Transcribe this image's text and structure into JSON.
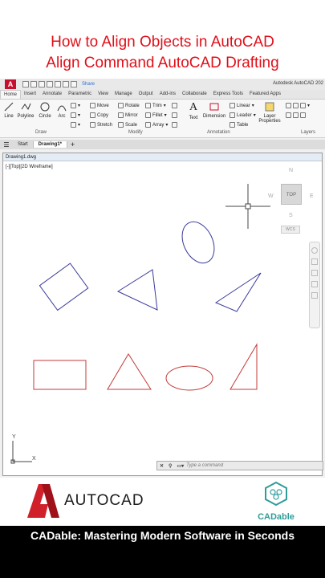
{
  "header": {
    "title_line1": "How to Align Objects in AutoCAD",
    "title_line2": "Align Command AutoCAD Drafting"
  },
  "qat": {
    "app_letter": "A",
    "share": "Share",
    "app_title": "Autodesk AutoCAD 202"
  },
  "tabs": [
    "Home",
    "Insert",
    "Annotate",
    "Parametric",
    "View",
    "Manage",
    "Output",
    "Add-ins",
    "Collaborate",
    "Express Tools",
    "Featured Apps"
  ],
  "ribbon": {
    "draw_tools": [
      "Line",
      "Polyline",
      "Circle",
      "Arc"
    ],
    "modify_tools": [
      "Move",
      "Rotate",
      "Trim",
      "Copy",
      "Mirror",
      "Fillet",
      "Stretch",
      "Scale",
      "Array"
    ],
    "annotation_tools": [
      "Text",
      "Dimension",
      "Linear",
      "Leader",
      "Table"
    ],
    "layer_tool": "Layer Properties",
    "panels": {
      "draw": "Draw",
      "modify": "Modify",
      "annotation": "Annotation",
      "layers": "Layers"
    }
  },
  "doc_tabs": {
    "start": "Start",
    "drawing": "Drawing1*"
  },
  "canvas": {
    "window_title": "Drawing1.dwg",
    "viewport_label": "[-][Top][2D Wireframe]",
    "viewcube": {
      "n": "N",
      "s": "S",
      "e": "E",
      "w": "W",
      "top": "TOP",
      "wcs": "WCS"
    },
    "ucs": {
      "x": "X",
      "y": "Y"
    }
  },
  "command_line": {
    "placeholder": "Type a command"
  },
  "footer": {
    "autocad_text": "AUTOCAD",
    "cadable_text": "CADable",
    "tagline": "CADable: Mastering Modern Software in Seconds"
  },
  "colors": {
    "title_red": "#e0101a",
    "shape_blue": "#3a3a9a",
    "shape_red": "#c43a3a",
    "teal": "#2f9c9a"
  }
}
